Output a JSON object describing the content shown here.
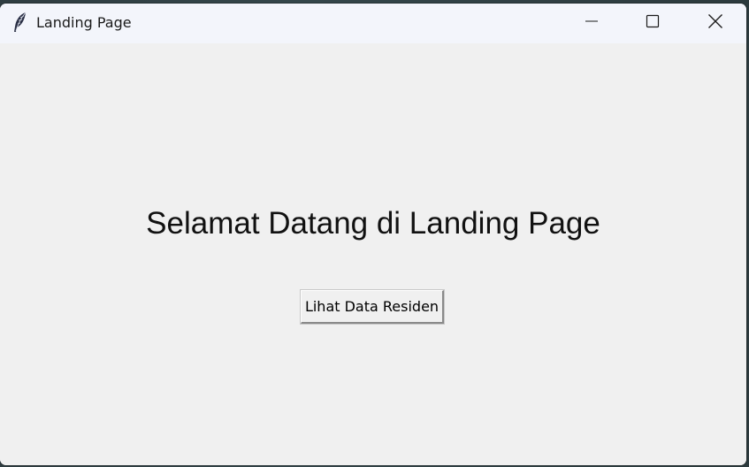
{
  "window": {
    "title": "Landing Page",
    "app_icon": "feather-icon",
    "controls": {
      "minimize_icon": "minimize-icon",
      "maximize_icon": "maximize-icon",
      "close_icon": "close-icon"
    }
  },
  "main": {
    "heading": "Selamat Datang di Landing Page",
    "button_label": "Lihat Data Residen"
  },
  "colors": {
    "titlebar_bg": "#f3f5fb",
    "content_bg": "#f0f0f0",
    "text": "#111111"
  }
}
